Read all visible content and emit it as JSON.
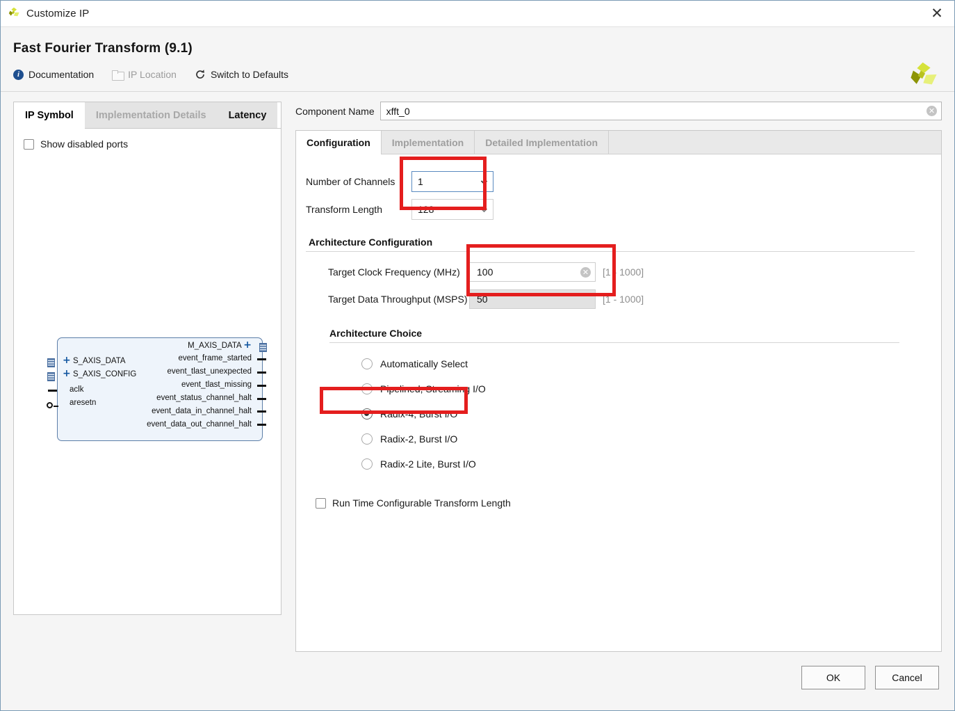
{
  "window": {
    "title": "Customize IP",
    "close_label": "✕",
    "logo_name": "xilinx-logo"
  },
  "header": {
    "title": "Fast Fourier Transform (9.1)",
    "toolbar": [
      {
        "label": "Documentation",
        "icon": "info-icon",
        "disabled": false
      },
      {
        "label": "IP Location",
        "icon": "folder-icon",
        "disabled": true
      },
      {
        "label": "Switch to Defaults",
        "icon": "refresh-icon",
        "disabled": false
      }
    ]
  },
  "left_panel": {
    "tabs": [
      {
        "label": "IP Symbol",
        "state": "active"
      },
      {
        "label": "Implementation Details",
        "state": "disabled"
      },
      {
        "label": "Latency",
        "state": "enabled"
      }
    ],
    "show_disabled_ports": {
      "label": "Show disabled ports",
      "checked": false
    },
    "symbol": {
      "left_ports": [
        {
          "name": "S_AXIS_DATA",
          "type": "bus"
        },
        {
          "name": "S_AXIS_CONFIG",
          "type": "bus"
        },
        {
          "name": "aclk",
          "type": "pin"
        },
        {
          "name": "aresetn",
          "type": "pin-inverted"
        }
      ],
      "right_ports": [
        {
          "name": "M_AXIS_DATA",
          "type": "bus"
        },
        {
          "name": "event_frame_started",
          "type": "pin"
        },
        {
          "name": "event_tlast_unexpected",
          "type": "pin"
        },
        {
          "name": "event_tlast_missing",
          "type": "pin"
        },
        {
          "name": "event_status_channel_halt",
          "type": "pin"
        },
        {
          "name": "event_data_in_channel_halt",
          "type": "pin"
        },
        {
          "name": "event_data_out_channel_halt",
          "type": "pin"
        }
      ]
    }
  },
  "right_panel": {
    "component_name": {
      "label": "Component Name",
      "value": "xfft_0",
      "clear_glyph": "✕"
    },
    "tabs": [
      {
        "label": "Configuration",
        "state": "active"
      },
      {
        "label": "Implementation",
        "state": "disabled"
      },
      {
        "label": "Detailed Implementation",
        "state": "disabled"
      }
    ],
    "number_of_channels": {
      "label": "Number of Channels",
      "value": "1",
      "focused": true
    },
    "transform_length": {
      "label": "Transform Length",
      "value": "128",
      "focused": false
    },
    "architecture_configuration": {
      "heading": "Architecture Configuration",
      "target_clock_frequency": {
        "label": "Target Clock Frequency (MHz)",
        "value": "100",
        "range": "[1 - 1000]",
        "disabled": false
      },
      "target_data_throughput": {
        "label": "Target Data Throughput (MSPS)",
        "value": "50",
        "range": "[1 - 1000]",
        "disabled": true
      }
    },
    "architecture_choice": {
      "heading": "Architecture Choice",
      "options": [
        {
          "label": "Automatically Select",
          "selected": false
        },
        {
          "label": "Pipelined, Streaming I/O",
          "selected": false
        },
        {
          "label": "Radix-4, Burst I/O",
          "selected": true
        },
        {
          "label": "Radix-2, Burst I/O",
          "selected": false
        },
        {
          "label": "Radix-2 Lite, Burst I/O",
          "selected": false
        }
      ]
    },
    "run_time_configurable": {
      "label": "Run Time Configurable Transform Length",
      "checked": false
    }
  },
  "footer": {
    "ok_label": "OK",
    "cancel_label": "Cancel"
  },
  "annotations": {
    "highlight_color": "#e41e1e",
    "boxes": [
      "channels-and-length-highlight",
      "clock-and-throughput-highlight",
      "radix4-option-highlight"
    ]
  }
}
